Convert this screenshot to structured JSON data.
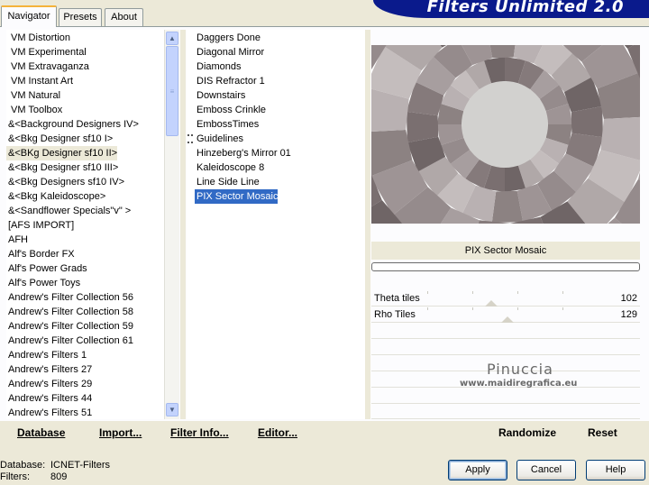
{
  "app": {
    "title": "Filters Unlimited 2.0"
  },
  "tabs": [
    {
      "label": "Navigator",
      "active": true
    },
    {
      "label": "Presets",
      "active": false
    },
    {
      "label": "About",
      "active": false
    }
  ],
  "categories": {
    "items": [
      "VM Distortion",
      "VM Experimental",
      "VM Extravaganza",
      "VM Instant Art",
      "VM Natural",
      "VM Toolbox",
      "&<Background Designers IV>",
      "&<Bkg Designer sf10 I>",
      "&<BKg Designer sf10 II>",
      "&<Bkg Designer sf10 III>",
      "&<Bkg Designers sf10 IV>",
      "&<Bkg Kaleidoscope>",
      "&<Sandflower Specials\"v\" >",
      "[AFS IMPORT]",
      "AFH",
      "Alf's Border FX",
      "Alf's Power Grads",
      "Alf's Power Toys",
      "Andrew's Filter Collection 56",
      "Andrew's Filter Collection 58",
      "Andrew's Filter Collection 59",
      "Andrew's Filter Collection 61",
      "Andrew's Filters 1",
      "Andrew's Filters 27",
      "Andrew's Filters 29",
      "Andrew's Filters 44",
      "Andrew's Filters 51"
    ],
    "highlighted_index": 8
  },
  "filters": {
    "items": [
      "Daggers Done",
      "Diagonal Mirror",
      "Diamonds",
      "DIS Refractor 1",
      "Downstairs",
      "Emboss Crinkle",
      "EmbossTimes",
      "Guidelines",
      "Hinzeberg's Mirror 01",
      "Kaleidoscope 8",
      "Line Side Line",
      "PIX Sector Mosaic"
    ],
    "selected_index": 11,
    "marker_index": 7
  },
  "preview": {
    "filter_name": "PIX Sector Mosaic",
    "progress": 0
  },
  "params": [
    {
      "name": "Theta tiles",
      "value": "102",
      "fraction": 0.4
    },
    {
      "name": "Rho Tiles",
      "value": "129",
      "fraction": 0.5
    }
  ],
  "watermark": {
    "name": "Pinuccia",
    "url": "www.maidiregrafica.eu"
  },
  "bottom_links": {
    "database": "Database",
    "import": "Import...",
    "filter_info": "Filter Info...",
    "editor": "Editor...",
    "randomize": "Randomize",
    "reset": "Reset"
  },
  "status": {
    "database_label": "Database:",
    "database_value": "ICNET-Filters",
    "filters_label": "Filters:",
    "filters_value": "809"
  },
  "dialog_buttons": {
    "apply": "Apply",
    "cancel": "Cancel",
    "help": "Help"
  },
  "colors": {
    "header_banner": "#0a1a8c",
    "selection": "#316ac5",
    "mosaic_center": "#d2d1cf"
  }
}
